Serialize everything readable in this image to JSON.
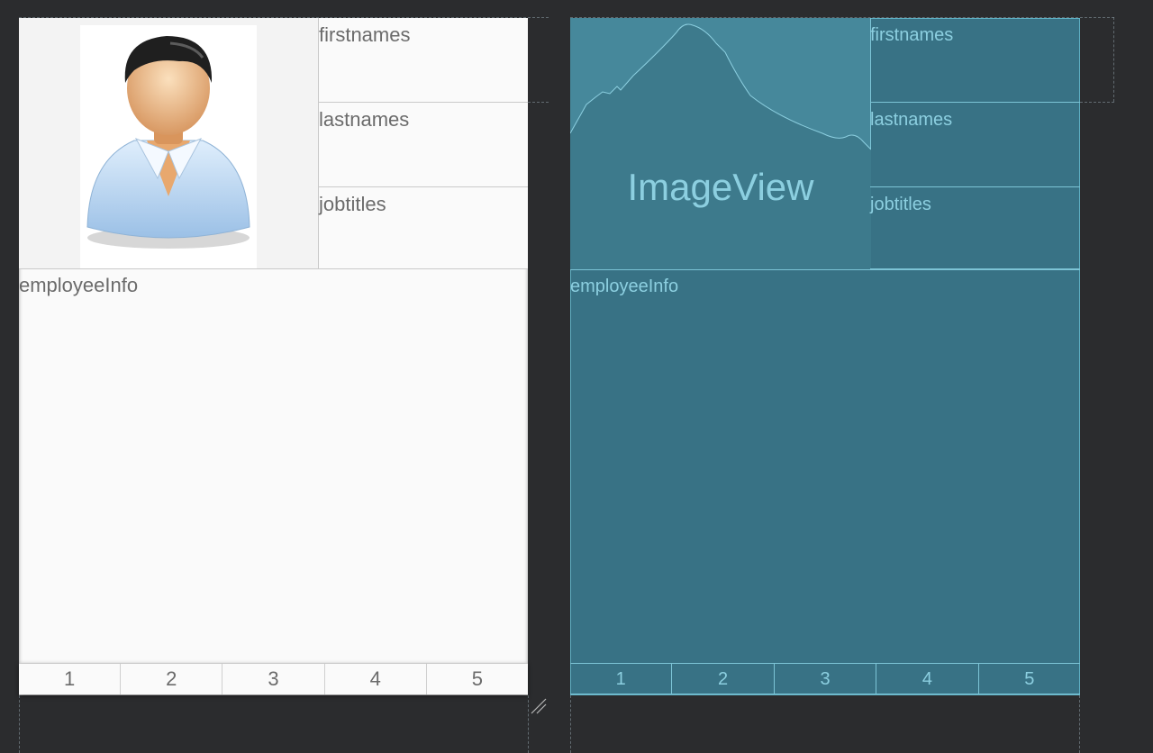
{
  "design": {
    "fields": [
      {
        "label": "firstnames"
      },
      {
        "label": "lastnames"
      },
      {
        "label": "jobtitles"
      }
    ],
    "info_label": "employeeInfo",
    "avatar_icon": "person-avatar-icon",
    "tabs": [
      "1",
      "2",
      "3",
      "4",
      "5"
    ]
  },
  "blueprint": {
    "image_label": "ImageView",
    "fields": [
      {
        "label": "firstnames"
      },
      {
        "label": "lastnames"
      },
      {
        "label": "jobtitles"
      }
    ],
    "info_label": "employeeInfo",
    "tabs": [
      "1",
      "2",
      "3",
      "4",
      "5"
    ]
  },
  "colors": {
    "canvas": "#2b2c2e",
    "design_surface": "#fafafa",
    "blueprint_surface": "#387285",
    "blueprint_line": "#7cc4d6",
    "blueprint_text": "#8ccfe0"
  }
}
